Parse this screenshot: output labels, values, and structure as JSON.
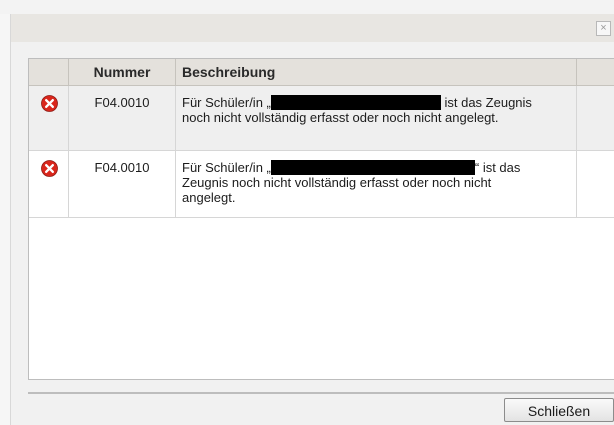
{
  "dialog": {
    "close_glyph": "×",
    "close_button_label": "Schließen"
  },
  "table": {
    "headers": {
      "number": "Nummer",
      "description": "Beschreibung"
    },
    "rows": [
      {
        "icon": "error-icon",
        "number": "F04.0010",
        "text_before": "Für Schüler/in „",
        "text_after": " ist das Zeugnis noch nicht vollständig erfasst oder noch nicht angelegt."
      },
      {
        "icon": "error-icon",
        "number": "F04.0010",
        "text_before": "Für Schüler/in „",
        "text_after": "“ ist das Zeugnis noch nicht vollständig erfasst oder noch nicht angelegt."
      }
    ]
  },
  "colors": {
    "error_red": "#d9261c",
    "header_bg": "#e4e1dc"
  }
}
